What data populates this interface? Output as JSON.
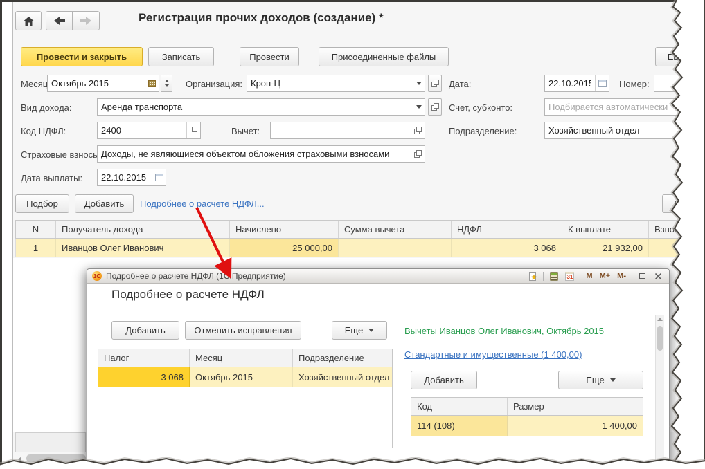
{
  "colors": {
    "accent_yellow": "#ffd74d",
    "selection_row_yellow": "#fdf1bf",
    "selection_cell_yellow": "#fbe69a",
    "selection_gold": "#fed22e",
    "link_blue": "#3a73c1",
    "context_green": "#2a9e50",
    "annotation_red": "#e01010"
  },
  "window": {
    "title": "Регистрация прочих доходов (создание) *",
    "toolbar": {
      "submit_close": "Провести и закрыть",
      "save": "Записать",
      "post": "Провести",
      "attached_files": "Присоединенные файлы",
      "more": "Еще"
    },
    "fields": {
      "month_label": "Месяц:",
      "month_value": "Октябрь 2015",
      "org_label": "Организация:",
      "org_value": "Крон-Ц",
      "date_label": "Дата:",
      "date_value": "22.10.2015",
      "number_label": "Номер:",
      "number_value": "",
      "income_type_label": "Вид дохода:",
      "income_type_value": "Аренда транспорта",
      "account_label": "Счет, субконто:",
      "account_placeholder": "Подбирается автоматически",
      "ndfl_code_label": "Код НДФЛ:",
      "ndfl_code_value": "2400",
      "deduction_label": "Вычет:",
      "deduction_value": "",
      "department_label": "Подразделение:",
      "department_value": "Хозяйственный отдел",
      "insurance_label": "Страховые взносы:",
      "insurance_value": "Доходы, не являющиеся объектом обложения страховыми взносами",
      "payment_date_label": "Дата выплаты:",
      "payment_date_value": "22.10.2015"
    },
    "commands": {
      "pick": "Подбор",
      "add": "Добавить",
      "ndfl_details_link": "Подробнее о расчете НДФЛ...",
      "more": "Еще"
    },
    "table": {
      "columns": [
        "N",
        "Получатель дохода",
        "Начислено",
        "Сумма вычета",
        "НДФЛ",
        "К выплате",
        "Взносы"
      ],
      "row": {
        "num": "1",
        "recipient": "Иванцов Олег Иванович",
        "accrued": "25 000,00",
        "deduction": "",
        "ndfl": "3 068",
        "payable": "21 932,00",
        "contributions": ""
      }
    }
  },
  "dialog": {
    "titlebar": {
      "logo_text": "1С",
      "title": "Подробнее о расчете НДФЛ (1С:Предприятие)",
      "calendar_icon_text": "31",
      "m": "M",
      "m_plus": "M+",
      "m_minus": "M-"
    },
    "heading": "Подробнее о расчете НДФЛ",
    "toolbar": {
      "add": "Добавить",
      "revert": "Отменить исправления",
      "more": "Еще"
    },
    "context_label": "Вычеты Иванцов Олег Иванович, Октябрь 2015",
    "tax_table": {
      "columns": [
        "Налог",
        "Месяц",
        "Подразделение"
      ],
      "row": {
        "tax": "3 068",
        "month": "Октябрь 2015",
        "department": "Хозяйственный отдел"
      }
    },
    "deductions": {
      "link": "Стандартные и имущественные (1 400,00)",
      "add": "Добавить",
      "more": "Еще",
      "table": {
        "columns": [
          "Код",
          "Размер"
        ],
        "row": {
          "code": "114 (108)",
          "size": "1 400,00"
        }
      }
    }
  }
}
